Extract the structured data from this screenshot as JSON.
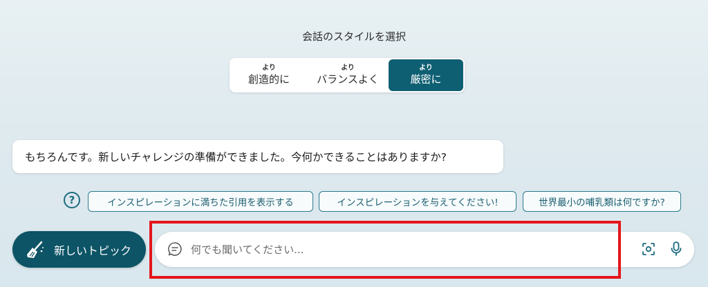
{
  "style_selector": {
    "title": "会話のスタイルを選択",
    "options": [
      {
        "prefix": "より",
        "label": "創造的に",
        "selected": false
      },
      {
        "prefix": "より",
        "label": "バランスよく",
        "selected": false
      },
      {
        "prefix": "より",
        "label": "厳密に",
        "selected": true
      }
    ]
  },
  "conversation": {
    "bot_message": "もちろんです。新しいチャレンジの準備ができました。今何かできることはありますか?"
  },
  "suggestions": {
    "help_glyph": "?",
    "items": [
      "インスピレーションに満ちた引用を表示する",
      "インスピレーションを与えてください!",
      "世界最小の哺乳類は何ですか?"
    ]
  },
  "new_topic": {
    "label": "新しいトピック",
    "icon": "broom-icon"
  },
  "input": {
    "placeholder": "何でも聞いてください...",
    "value": "",
    "icons": [
      "chat-icon",
      "camera-icon",
      "microphone-icon"
    ]
  },
  "colors": {
    "accent": "#0f5f73",
    "button_bg": "#0c5466",
    "highlight": "#e4161b"
  }
}
